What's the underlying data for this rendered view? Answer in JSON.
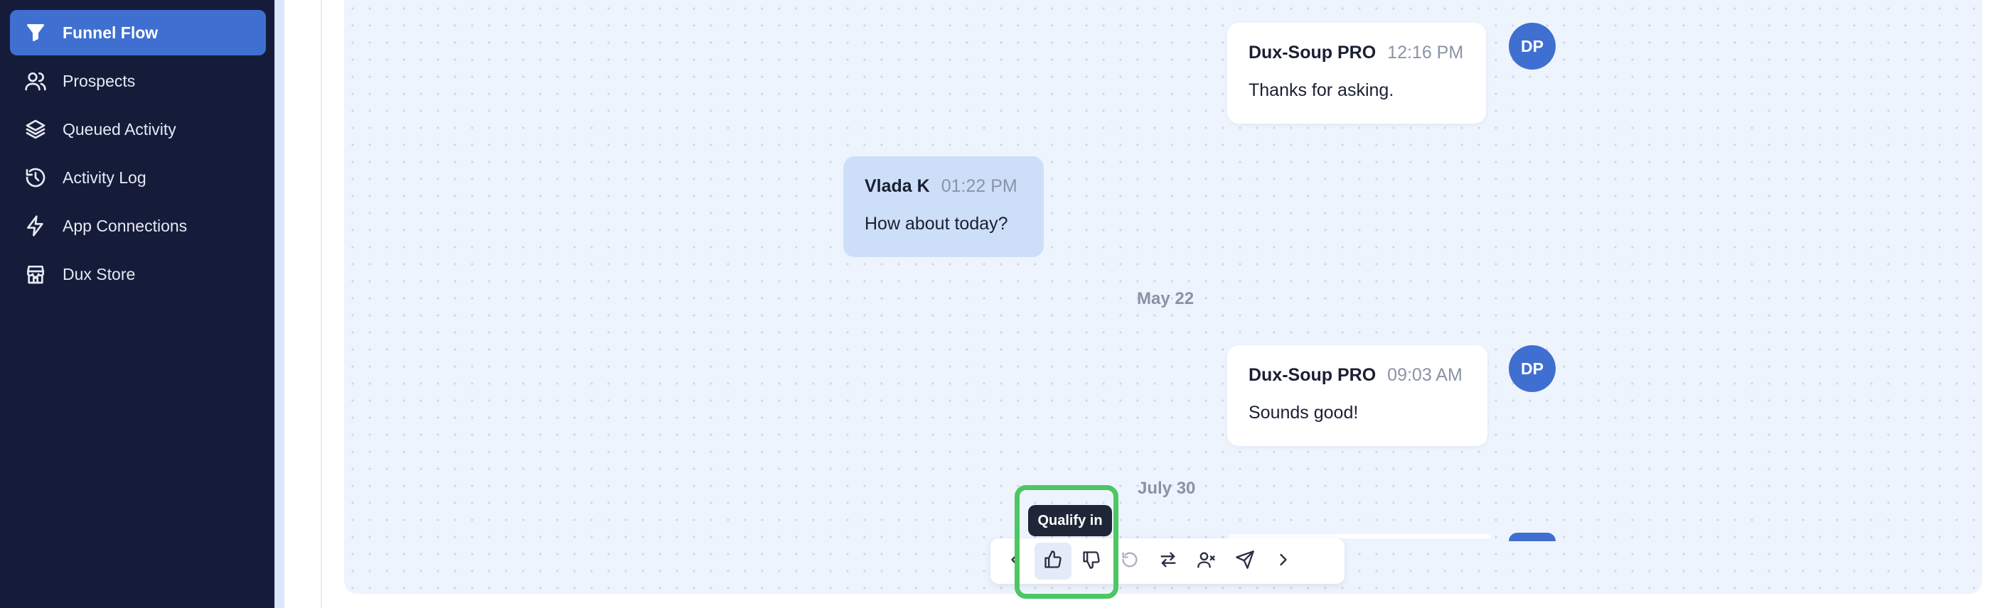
{
  "sidebar": {
    "items": [
      {
        "label": "Funnel Flow",
        "icon": "funnel-icon",
        "active": true
      },
      {
        "label": "Prospects",
        "icon": "users-icon"
      },
      {
        "label": "Queued Activity",
        "icon": "layers-icon"
      },
      {
        "label": "Activity Log",
        "icon": "history-icon"
      },
      {
        "label": "App Connections",
        "icon": "lightning-icon"
      },
      {
        "label": "Dux Store",
        "icon": "store-icon"
      }
    ]
  },
  "chat": {
    "messages": [
      {
        "sender": "Dux-Soup PRO",
        "time": "12:16 PM",
        "text": "Thanks for asking.",
        "direction": "out",
        "avatar": "DP"
      },
      {
        "sender": "Vlada K",
        "time": "01:22 PM",
        "text": "How about today?",
        "direction": "in"
      },
      {
        "sender": "Dux-Soup PRO",
        "time": "09:03 AM",
        "text": "Sounds good!",
        "direction": "out",
        "avatar": "DP"
      }
    ],
    "date_separators": [
      "May 22",
      "July 30"
    ]
  },
  "toolbar": {
    "buttons": [
      {
        "icon": "chevron-left-icon",
        "name": "previous-button"
      },
      {
        "icon": "thumbs-up-icon",
        "name": "qualify-in-button",
        "state": "hover"
      },
      {
        "icon": "thumbs-down-icon",
        "name": "qualify-out-button"
      },
      {
        "icon": "undo-icon",
        "name": "undo-button",
        "state": "disabled"
      },
      {
        "icon": "swap-arrows-icon",
        "name": "swap-button"
      },
      {
        "icon": "user-remove-icon",
        "name": "remove-prospect-button"
      },
      {
        "icon": "send-icon",
        "name": "send-button"
      },
      {
        "icon": "chevron-right-icon",
        "name": "next-button"
      }
    ],
    "tooltip": "Qualify in"
  },
  "colors": {
    "sidebar_bg": "#151c3a",
    "accent": "#3f6fd0",
    "chat_bg": "#eef4fd",
    "incoming_bubble": "#cddff8",
    "highlight": "#4cc763"
  }
}
